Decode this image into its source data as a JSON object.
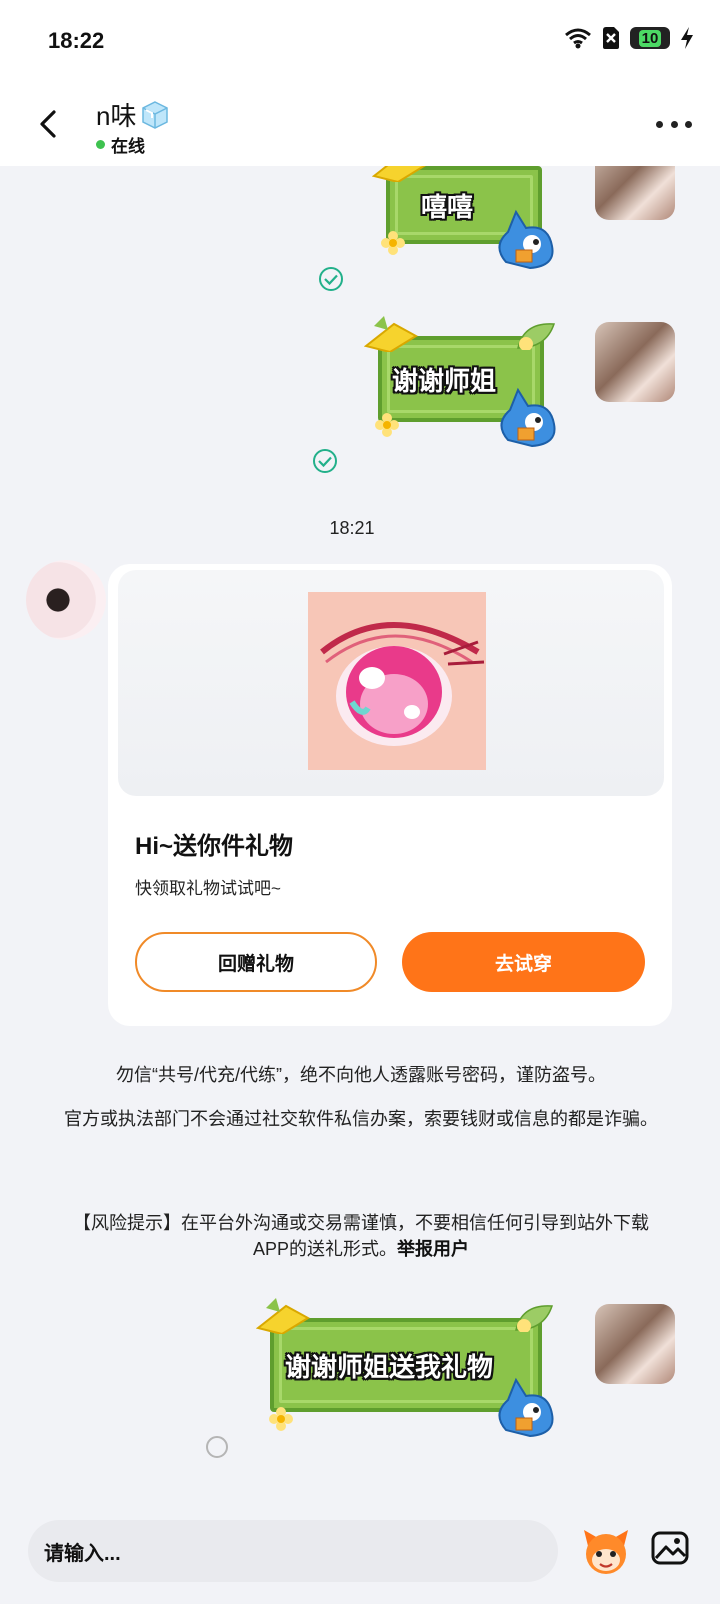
{
  "status_bar": {
    "time": "18:22",
    "battery": "10"
  },
  "header": {
    "name": "n味",
    "name_icon": "ice-cube-icon",
    "status": "在线"
  },
  "messages": [
    {
      "type": "sticker",
      "side": "right",
      "text": "嘻嘻",
      "read": true
    },
    {
      "type": "sticker",
      "side": "right",
      "text": "谢谢师姐",
      "read": true
    },
    {
      "type": "time",
      "text": "18:21"
    },
    {
      "type": "gift",
      "side": "left",
      "title": "Hi~送你件礼物",
      "subtitle": "快领取礼物试试吧~",
      "secondary_button": "回赠礼物",
      "primary_button": "去试穿"
    },
    {
      "type": "sticker",
      "side": "right",
      "text": "谢谢师姐送我礼物",
      "read": false
    }
  ],
  "notices": {
    "line1": "勿信“共号/代充/代练”，绝不向他人透露账号密码，谨防盗号。",
    "line2": "官方或执法部门不会通过社交软件私信办案，索要钱财或信息的都是诈骗。",
    "line3": "【风险提示】在平台外沟通或交易需谨慎，不要相信任何引导到站外下载APP的送礼形式。",
    "report_link": "举报用户"
  },
  "input": {
    "placeholder": "请输入..."
  },
  "colors": {
    "accent_orange": "#ff7418",
    "online_green": "#3ec24f",
    "sticker_green": "#8bc34a"
  }
}
